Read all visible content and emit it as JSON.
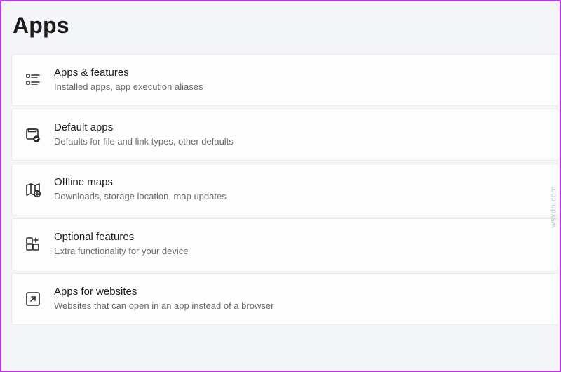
{
  "page": {
    "title": "Apps"
  },
  "rows": [
    {
      "icon": "apps-features-icon",
      "title": "Apps & features",
      "subtitle": "Installed apps, app execution aliases"
    },
    {
      "icon": "default-apps-icon",
      "title": "Default apps",
      "subtitle": "Defaults for file and link types, other defaults"
    },
    {
      "icon": "offline-maps-icon",
      "title": "Offline maps",
      "subtitle": "Downloads, storage location, map updates"
    },
    {
      "icon": "optional-features-icon",
      "title": "Optional features",
      "subtitle": "Extra functionality for your device"
    },
    {
      "icon": "apps-for-websites-icon",
      "title": "Apps for websites",
      "subtitle": "Websites that can open in an app instead of a browser"
    }
  ],
  "watermark": "wsxdn.com"
}
